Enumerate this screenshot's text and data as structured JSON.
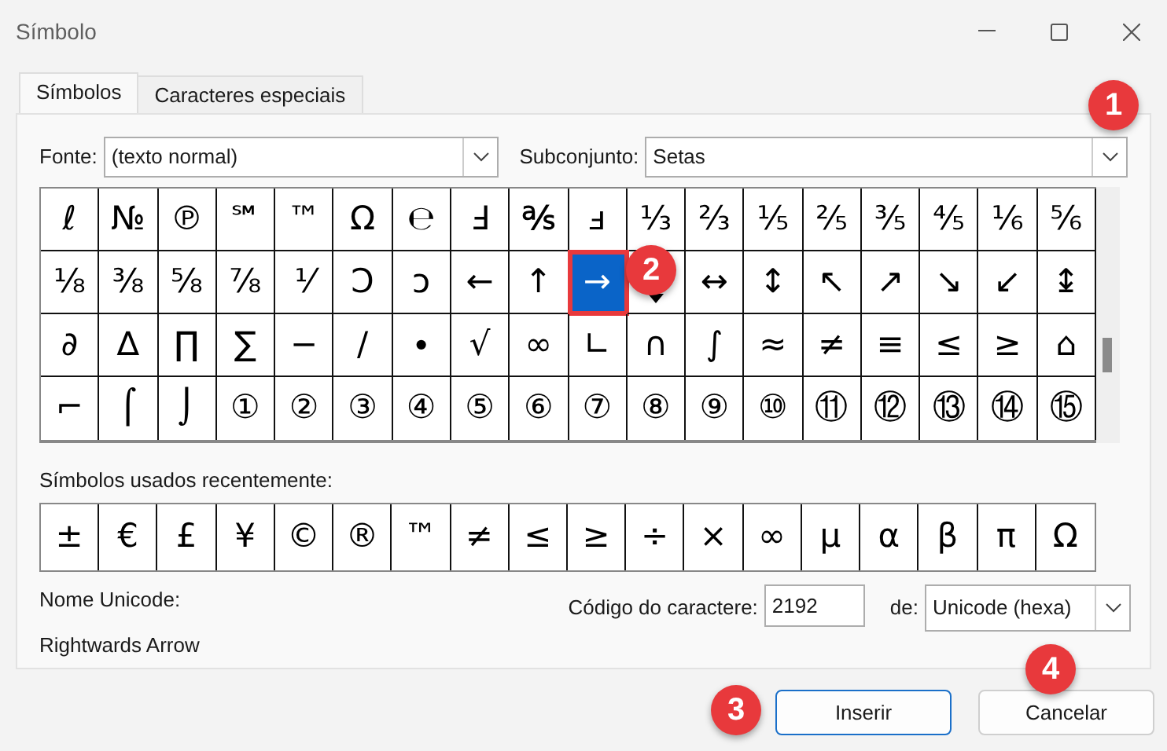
{
  "window": {
    "title": "Símbolo"
  },
  "tabs": [
    {
      "label": "Símbolos",
      "selected": true
    },
    {
      "label": "Caracteres especiais",
      "selected": false
    }
  ],
  "font": {
    "label": "Fonte:",
    "value": "(texto normal)"
  },
  "subset": {
    "label": "Subconjunto:",
    "value": "Setas"
  },
  "symbol_grid": {
    "rows": [
      [
        {
          "char": "ℓ",
          "selected": false
        },
        {
          "char": "№",
          "selected": false
        },
        {
          "char": "℗",
          "selected": false
        },
        {
          "char": "℠",
          "selected": false
        },
        {
          "char": "™",
          "selected": false
        },
        {
          "char": "Ω",
          "selected": false
        },
        {
          "char": "℮",
          "selected": false
        },
        {
          "char": "Ⅎ",
          "selected": false
        },
        {
          "char": "℁",
          "selected": false
        },
        {
          "char": "ⅎ",
          "selected": false
        },
        {
          "char": "⅓",
          "selected": false
        },
        {
          "char": "⅔",
          "selected": false
        },
        {
          "char": "⅕",
          "selected": false
        },
        {
          "char": "⅖",
          "selected": false
        },
        {
          "char": "⅗",
          "selected": false
        },
        {
          "char": "⅘",
          "selected": false
        },
        {
          "char": "⅙",
          "selected": false
        },
        {
          "char": "⅚",
          "selected": false
        }
      ],
      [
        {
          "char": "⅛",
          "selected": false
        },
        {
          "char": "⅜",
          "selected": false
        },
        {
          "char": "⅝",
          "selected": false
        },
        {
          "char": "⅞",
          "selected": false
        },
        {
          "char": "⅟",
          "selected": false
        },
        {
          "char": "Ↄ",
          "selected": false
        },
        {
          "char": "ↄ",
          "selected": false
        },
        {
          "char": "←",
          "selected": false
        },
        {
          "char": "↑",
          "selected": false
        },
        {
          "char": "→",
          "selected": true
        },
        {
          "kind": "covered"
        },
        {
          "char": "↔",
          "selected": false
        },
        {
          "char": "↕",
          "selected": false
        },
        {
          "char": "↖",
          "selected": false
        },
        {
          "char": "↗",
          "selected": false
        },
        {
          "char": "↘",
          "selected": false
        },
        {
          "char": "↙",
          "selected": false
        },
        {
          "char": "↨",
          "selected": false
        }
      ],
      [
        {
          "char": "∂",
          "selected": false
        },
        {
          "char": "∆",
          "selected": false
        },
        {
          "char": "∏",
          "selected": false
        },
        {
          "char": "∑",
          "selected": false
        },
        {
          "char": "−",
          "selected": false
        },
        {
          "char": "∕",
          "selected": false
        },
        {
          "char": "∙",
          "selected": false
        },
        {
          "char": "√",
          "selected": false
        },
        {
          "char": "∞",
          "selected": false
        },
        {
          "char": "∟",
          "selected": false
        },
        {
          "char": "∩",
          "selected": false
        },
        {
          "char": "∫",
          "selected": false
        },
        {
          "char": "≈",
          "selected": false
        },
        {
          "char": "≠",
          "selected": false
        },
        {
          "char": "≡",
          "selected": false
        },
        {
          "char": "≤",
          "selected": false
        },
        {
          "char": "≥",
          "selected": false
        },
        {
          "char": "⌂",
          "selected": false
        }
      ],
      [
        {
          "char": "⌐",
          "selected": false
        },
        {
          "char": "⌠",
          "selected": false
        },
        {
          "char": "⌡",
          "selected": false
        },
        {
          "char": "①",
          "selected": false
        },
        {
          "char": "②",
          "selected": false
        },
        {
          "char": "③",
          "selected": false
        },
        {
          "char": "④",
          "selected": false
        },
        {
          "char": "⑤",
          "selected": false
        },
        {
          "char": "⑥",
          "selected": false
        },
        {
          "char": "⑦",
          "selected": false
        },
        {
          "char": "⑧",
          "selected": false
        },
        {
          "char": "⑨",
          "selected": false
        },
        {
          "char": "⑩",
          "selected": false
        },
        {
          "char": "⑪",
          "selected": false
        },
        {
          "char": "⑫",
          "selected": false
        },
        {
          "char": "⑬",
          "selected": false
        },
        {
          "char": "⑭",
          "selected": false
        },
        {
          "char": "⑮",
          "selected": false
        }
      ]
    ]
  },
  "recent": {
    "label": "Símbolos usados recentemente:",
    "symbols": [
      "±",
      "€",
      "£",
      "¥",
      "©",
      "®",
      "™",
      "≠",
      "≤",
      "≥",
      "÷",
      "×",
      "∞",
      "µ",
      "α",
      "β",
      "π",
      "Ω"
    ]
  },
  "unicode_name": {
    "label": "Nome Unicode:",
    "value": "Rightwards Arrow"
  },
  "char_code": {
    "label": "Código do caractere:",
    "value": "2192"
  },
  "code_from": {
    "label": "de:",
    "value": "Unicode (hexa)"
  },
  "buttons": [
    {
      "label": "Inserir",
      "default": true
    },
    {
      "label": "Cancelar",
      "default": false
    }
  ],
  "callouts": [
    "1",
    "2",
    "3",
    "4"
  ]
}
